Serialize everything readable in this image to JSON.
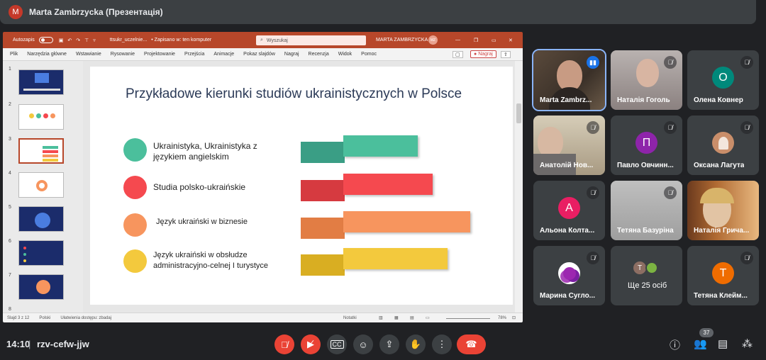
{
  "presenter_bar": {
    "avatar_letter": "M",
    "title": "Marta Zambrzycka (Презентація)"
  },
  "powerpoint": {
    "autosave_label": "Autozapis",
    "filename": "ttsukr_uczelnie...",
    "saved_status": "• Zapisano w: ten komputer",
    "search_placeholder": "Wyszukaj",
    "user_name": "MARTA ZAMBRZYCKA",
    "user_initials": "MZ",
    "ribbon_tabs": [
      "Plik",
      "Narzędzia główne",
      "Wstawianie",
      "Rysowanie",
      "Projektowanie",
      "Przejścia",
      "Animacje",
      "Pokaz slajdów",
      "Nagraj",
      "Recenzja",
      "Widok",
      "Pomoc"
    ],
    "record_button": "Nagraj",
    "slide_numbers": [
      "1",
      "2",
      "3",
      "4",
      "5",
      "6",
      "7",
      "8"
    ],
    "status": {
      "slide": "Slajd 3 z 12",
      "language": "Polski",
      "accessibility": "Ułatwienia dostępu: zbadaj",
      "notes": "Notatki",
      "zoom": "78%"
    }
  },
  "slide": {
    "title": "Przykładowe kierunki studiów ukrainistycznych w Polsce",
    "items": [
      {
        "text": "Ukrainistyka, Ukrainistyka z językiem angielskim",
        "color": "#4bbf9c"
      },
      {
        "text": "Studia polsko-ukraińskie",
        "color": "#f5494f"
      },
      {
        "text": "Język ukraiński w biznesie",
        "color": "#f7955e"
      },
      {
        "text": "Język ukraiński w obsłudze administracyjno-celnej I turystyce",
        "color": "#f3c93d"
      }
    ]
  },
  "participants": [
    {
      "name": "Marta Zambrz...",
      "speaking": true
    },
    {
      "name": "Наталія Гоголь"
    },
    {
      "name": "Олена Ковнер",
      "initial": "О",
      "color": "#00897b"
    },
    {
      "name": "Анатолій Нов..."
    },
    {
      "name": "Павло Овчинн...",
      "initial": "П",
      "color": "#8e24aa"
    },
    {
      "name": "Оксана Лагута"
    },
    {
      "name": "Альона Колта...",
      "initial": "А",
      "color": "#e91e63"
    },
    {
      "name": "Тетяна Базуріна"
    },
    {
      "name": "Наталія Грича..."
    },
    {
      "name": "Марина Сугло..."
    },
    {
      "name": "Ще 25 осіб",
      "mini_initial": "Т"
    },
    {
      "name": "Тетяна Клейм...",
      "initial": "Т",
      "color": "#ef6c00"
    }
  ],
  "bottom_bar": {
    "time": "14:10",
    "separator": "|",
    "meeting_code": "rzv-cefw-jjw",
    "participant_count": "37"
  }
}
